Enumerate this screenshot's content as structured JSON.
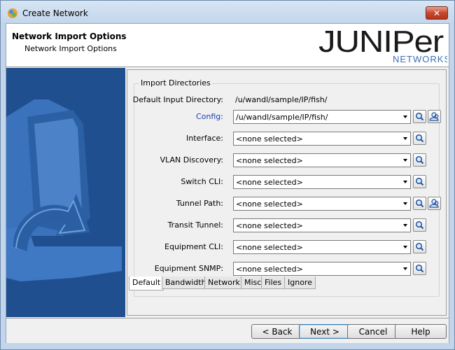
{
  "window": {
    "title": "Create Network",
    "close_label": "✕"
  },
  "header": {
    "title": "Network Import Options",
    "subtitle": "Network Import Options",
    "logo_wordmark": "JUNIPer",
    "logo_subtext": "NETWORKS",
    "brand_color": "#1a1a1a",
    "brand_sub_color": "#3a6fb5"
  },
  "import": {
    "group_title": "Import Directories",
    "default_input_label": "Default Input Directory:",
    "default_input_value": "/u/wandl/sample/IP/fish/",
    "rows": [
      {
        "label": "Config:",
        "value": "/u/wandl/sample/IP/fish/",
        "is_link": true,
        "has_browse": true
      },
      {
        "label": "Interface:",
        "value": "<none selected>",
        "is_link": false,
        "has_browse": false
      },
      {
        "label": "VLAN Discovery:",
        "value": "<none selected>",
        "is_link": false,
        "has_browse": false
      },
      {
        "label": "Switch CLI:",
        "value": "<none selected>",
        "is_link": false,
        "has_browse": false
      },
      {
        "label": "Tunnel Path:",
        "value": "<none selected>",
        "is_link": false,
        "has_browse": true
      },
      {
        "label": "Transit Tunnel:",
        "value": "<none selected>",
        "is_link": false,
        "has_browse": false
      },
      {
        "label": "Equipment CLI:",
        "value": "<none selected>",
        "is_link": false,
        "has_browse": false
      },
      {
        "label": "Equipment SNMP:",
        "value": "<none selected>",
        "is_link": false,
        "has_browse": false
      }
    ]
  },
  "tabs": [
    {
      "label": "Default",
      "active": true
    },
    {
      "label": "Bandwidth",
      "active": false
    },
    {
      "label": "Network",
      "active": false
    },
    {
      "label": "Misc",
      "active": false
    },
    {
      "label": "Files",
      "active": false
    },
    {
      "label": "Ignore",
      "active": false
    }
  ],
  "footer": {
    "back_label": "< Back",
    "next_label": "Next >",
    "cancel_label": "Cancel",
    "help_label": "Help"
  }
}
